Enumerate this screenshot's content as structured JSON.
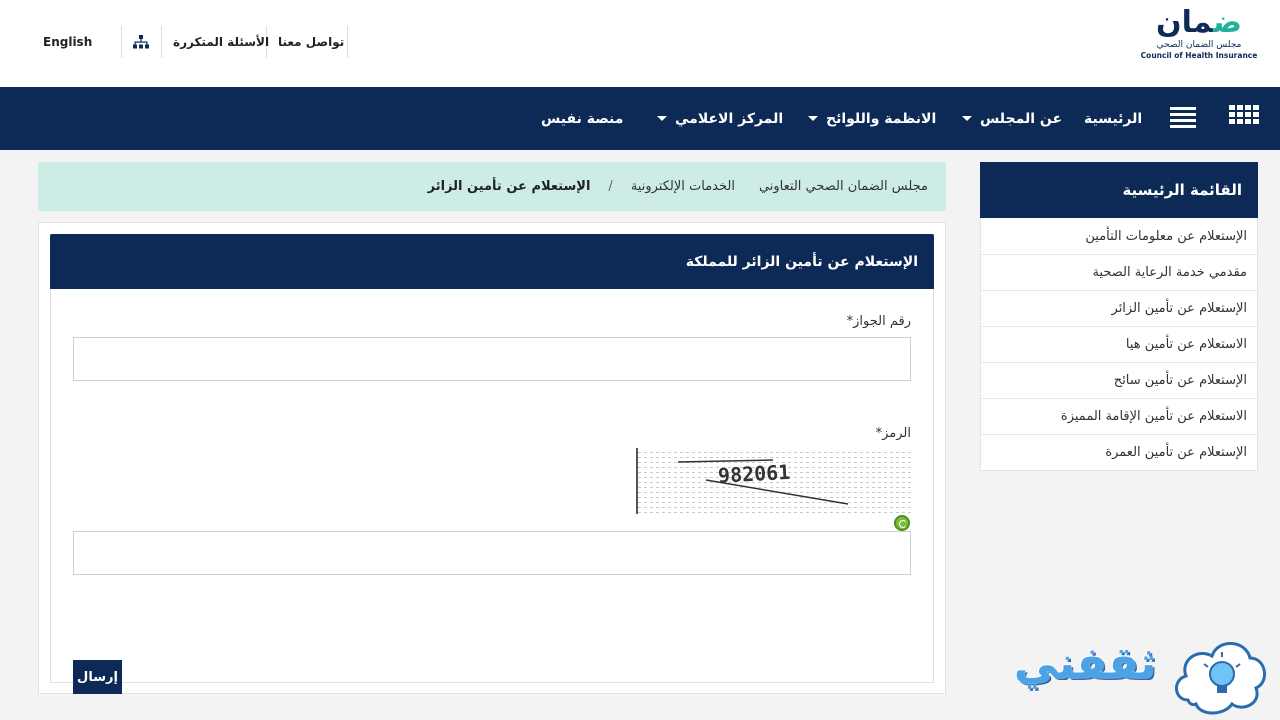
{
  "header": {
    "logo": {
      "main": "ضمان",
      "arabic_sub": "مجلس الضمان الصحي",
      "english_sub": "Council of Health Insurance"
    },
    "links": {
      "contact": "تواصل معنا",
      "faq": "الأسئلة المتكررة",
      "language": "English"
    },
    "sitemap_icon": "sitemap-icon"
  },
  "nav": {
    "home": "الرئيسية",
    "about": "عن المجلس",
    "regulations": "الانظمة واللوائح",
    "media": "المركز الاعلامي",
    "nafees": "منصة نفيس",
    "grid_icon": "apps-grid-icon",
    "menu_icon": "hamburger-menu-icon"
  },
  "breadcrumb": {
    "home": "مجلس الضمان الصحي التعاوني",
    "services": "الخدمات الإلكترونية",
    "separator": "/",
    "current": "الإستعلام عن تأمين الزائر"
  },
  "sidebar": {
    "title": "القائمة الرئيسية",
    "items": [
      {
        "label": "الإستعلام عن معلومات التأمين"
      },
      {
        "label": "مقدمي خدمة الرعاية الصحية"
      },
      {
        "label": "الإستعلام عن تأمين الزائر"
      },
      {
        "label": "الاستعلام عن تأمين هيا"
      },
      {
        "label": "الإستعلام عن تأمين سائح"
      },
      {
        "label": "الاستعلام عن تأمين الإقامة المميزة"
      },
      {
        "label": "الإستعلام عن تأمين العمرة"
      }
    ]
  },
  "form": {
    "title": "الإستعلام عن تأمين الزائر للمملكة",
    "passport_label": "رقم الجواز*",
    "passport_value": "",
    "code_label": "الرمز*",
    "code_value": "",
    "captcha_text": "982061",
    "refresh_icon": "refresh-captcha-icon",
    "submit_label": "إرسال"
  },
  "watermark": {
    "text": "ثقفني",
    "icon": "lightbulb-cloud-icon"
  },
  "colors": {
    "navy": "#0d2a57",
    "mint": "#cdece6",
    "green_logo": "#20b39a"
  }
}
